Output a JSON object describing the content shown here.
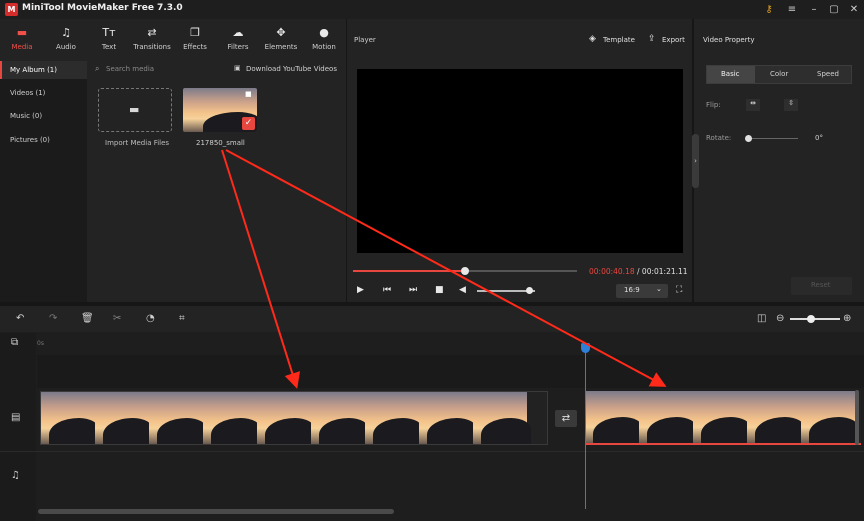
{
  "app": {
    "title": "MiniTool MovieMaker Free 7.3.0",
    "logo_icon": "minitool-logo"
  },
  "window_controls": [
    "key-icon",
    "menu-icon",
    "minimize-icon",
    "maximize-icon",
    "close-icon"
  ],
  "toolbar": {
    "tabs": [
      {
        "label": "Media",
        "icon": "folder-icon",
        "glyph": "▬",
        "active": true
      },
      {
        "label": "Audio",
        "icon": "music-note-icon",
        "glyph": "♫",
        "active": false
      },
      {
        "label": "Text",
        "icon": "text-icon",
        "glyph": "Tт",
        "active": false
      },
      {
        "label": "Transitions",
        "icon": "transitions-icon",
        "glyph": "⇄",
        "active": false
      },
      {
        "label": "Effects",
        "icon": "effects-icon",
        "glyph": "❐",
        "active": false
      },
      {
        "label": "Filters",
        "icon": "filters-icon",
        "glyph": "☁",
        "active": false
      },
      {
        "label": "Elements",
        "icon": "elements-icon",
        "glyph": "✥",
        "active": false
      },
      {
        "label": "Motion",
        "icon": "motion-icon",
        "glyph": "●",
        "active": false
      }
    ]
  },
  "sidebar": {
    "items": [
      "My Album (1)",
      "Videos (1)",
      "Music (0)",
      "Pictures (0)"
    ]
  },
  "media": {
    "search_placeholder": "Search media",
    "download_label": "Download YouTube Videos",
    "import_label": "Import Media Files",
    "clip_name": "217850_small"
  },
  "player": {
    "title": "Player",
    "template_label": "Template",
    "export_label": "Export",
    "time_current": "00:00:40.18",
    "time_separator": " / ",
    "time_total": "00:01:21.11",
    "aspect_ratio": "16:9",
    "progress": 0.5,
    "volume": 0.9
  },
  "video_property": {
    "title": "Video Property",
    "tabs": [
      "Basic",
      "Color",
      "Speed"
    ],
    "active_tab": "Basic",
    "flip_label": "Flip:",
    "rotate_label": "Rotate:",
    "rotate_value": "0°",
    "reset_label": "Reset"
  },
  "timeline": {
    "ruler_start": "0s",
    "tools": [
      "undo-icon",
      "redo-icon",
      "delete-icon",
      "split-icon",
      "speed-icon",
      "crop-icon"
    ]
  },
  "colors": {
    "accent": "#e8473f",
    "playhead": "#2f7fd6",
    "annotation_arrow": "#ff2a1a"
  }
}
